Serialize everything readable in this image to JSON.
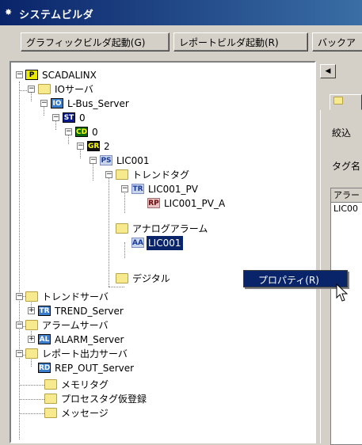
{
  "window": {
    "title": "システムビルダ"
  },
  "toolbar": {
    "graphic_label": "グラフィックビルダ起動(G)",
    "report_label": "レポートビルダ起動(R)",
    "backup_label": "バックア"
  },
  "tree": {
    "root": "SCADALINX",
    "io_server": "IOサーバ",
    "lbus": "L-Bus_Server",
    "st": "0",
    "cd": "0",
    "gr": "2",
    "ps": "LIC001",
    "trend_tag": "トレンドタグ",
    "tr_item": "LIC001_PV",
    "rp_item": "LIC001_PV_A",
    "analog_alarm": "アナログアラーム",
    "aa_item": "LIC001",
    "digital": "デジタル",
    "trend_server": "トレンドサーバ",
    "trend_server_item": "TREND_Server",
    "alarm_server": "アラームサーバ",
    "alarm_server_item": "ALARM_Server",
    "report_server": "レポート出力サーバ",
    "report_server_item": "REP_OUT_Server",
    "memory_tag": "メモリタグ",
    "process_tag": "プロセスタグ仮登録",
    "message": "メッセージ"
  },
  "icons": {
    "p": "P",
    "io": "IO",
    "st": "ST",
    "cd": "CD",
    "gr": "GR",
    "ps": "PS",
    "tr": "TR",
    "rp": "RP",
    "aa": "AA",
    "al": "AL",
    "rd": "RD"
  },
  "context_menu": {
    "properties": "プロパティ(R)"
  },
  "right_panel": {
    "filter_label": "絞込",
    "tag_label": "タグ名",
    "col_header": "アラー",
    "row_value": "LIC00"
  },
  "colors": {
    "selection": "#0a246a",
    "folder": "#f7e98e"
  }
}
